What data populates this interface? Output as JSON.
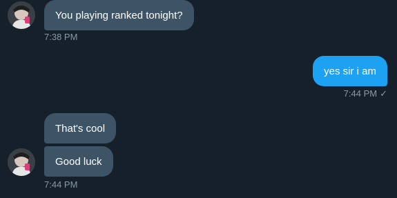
{
  "messages": [
    {
      "direction": "incoming",
      "text": "You playing ranked tonight?",
      "time": "7:38 PM"
    },
    {
      "direction": "outgoing",
      "text": "yes sir i am",
      "time": "7:44 PM",
      "status_icon": "checkmark-icon",
      "status_glyph": "✓"
    },
    {
      "direction": "incoming",
      "text": "That's cool"
    },
    {
      "direction": "incoming",
      "text": "Good luck",
      "time": "7:44 PM"
    }
  ],
  "colors": {
    "background": "#15202b",
    "incoming_bubble": "#3d5466",
    "outgoing_bubble": "#1da1f2",
    "meta_text": "#8899a6"
  }
}
